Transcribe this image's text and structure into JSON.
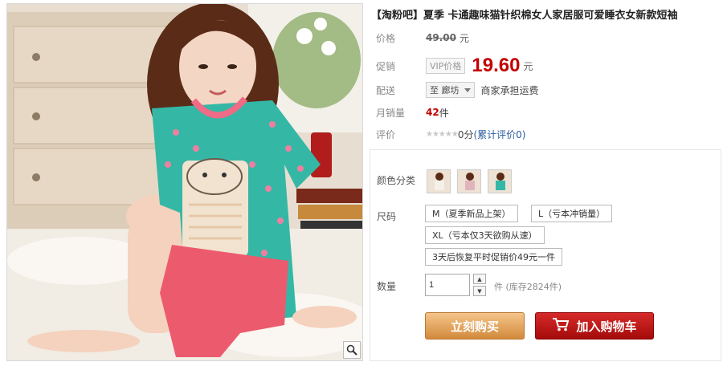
{
  "product": {
    "title": "【淘粉吧】夏季 卡通趣味猫针织棉女人家居服可爱睡衣女新款短袖"
  },
  "price": {
    "label": "价格",
    "original": "49.00",
    "unit": "元"
  },
  "promo": {
    "label": "促销",
    "vip_tag": "VIP价格",
    "price": "19.60",
    "unit": "元"
  },
  "shipping": {
    "label": "配送",
    "select_value": "至 廊坊",
    "note": "商家承担运费"
  },
  "sales": {
    "label": "月销量",
    "count": "42",
    "unit": "件"
  },
  "review": {
    "label": "评价",
    "stars": "★★★★★",
    "score": "0分",
    "link": "(累计评价0)"
  },
  "options": {
    "color_label": "颜色分类",
    "size_label": "尺码",
    "sizes": [
      "M（夏季新品上架）",
      "L（亏本冲销量）",
      "XL（亏本仅3天欲购从速）",
      "3天后恢复平时促销价49元一件"
    ],
    "qty_label": "数量",
    "qty_value": "1",
    "qty_unit": "件",
    "stock": "(库存2824件)"
  },
  "actions": {
    "buy_now": "立刻购买",
    "add_cart": "加入购物车"
  },
  "icons": {
    "zoom": "magnifier-icon",
    "cart": "cart-icon"
  },
  "colors": {
    "accent_red": "#c40000",
    "buy_orange": "#d28a3c",
    "cart_red": "#b01010",
    "shirt_teal": "#35b7a6",
    "shorts_pink": "#ec5a6e"
  }
}
